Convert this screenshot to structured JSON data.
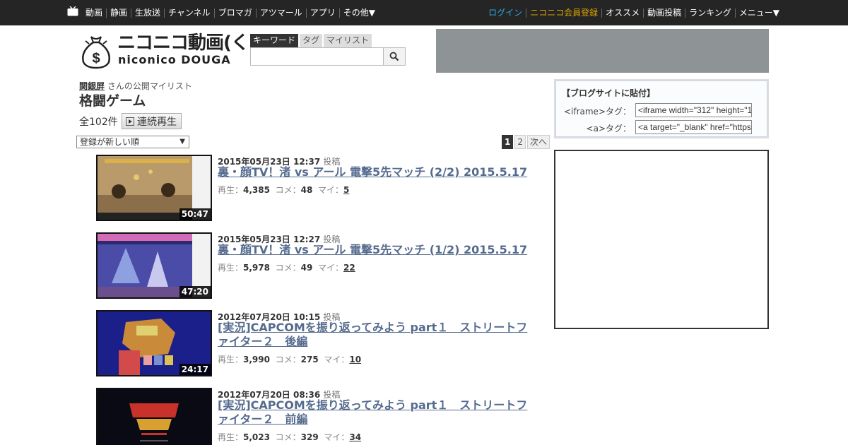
{
  "topbar": {
    "left_nav": [
      "動画",
      "静画",
      "生放送",
      "チャンネル",
      "ブロマガ",
      "アツマール",
      "アプリ",
      "その他▼"
    ],
    "login": "ログイン",
    "premium": "ニコニコ会員登録",
    "right_nav": [
      "オススメ",
      "動画投稿",
      "ランキング",
      "メニュー▼"
    ]
  },
  "logo": {
    "jp": "ニコニコ動画(く)",
    "en": "niconico DOUGA"
  },
  "search": {
    "tabs": [
      "キーワード",
      "タグ",
      "マイリスト"
    ],
    "placeholder": ""
  },
  "mylist": {
    "owner": "関銀屏",
    "owner_suffix": " さんの公開マイリスト",
    "title": "格闘ゲーム",
    "count": "全102件",
    "play_all": "連続再生",
    "sort": "登録が新しい順"
  },
  "pager": {
    "current": "1",
    "page2": "2",
    "next": "次へ"
  },
  "stats_labels": {
    "play": "再生：",
    "comment": "コメ：",
    "mylist": "マイ：",
    "posted": "投稿"
  },
  "videos": [
    {
      "date": "2015年05月23日 12:37",
      "title": "裏・顔TV！渚 vs アール 電撃5先マッチ (2/2) 2015.5.17",
      "duration": "50:47",
      "plays": "4,385",
      "comments": "48",
      "mylists": "5"
    },
    {
      "date": "2015年05月23日 12:27",
      "title": "裏・顔TV！渚 vs アール 電撃5先マッチ (1/2) 2015.5.17",
      "duration": "47:20",
      "plays": "5,978",
      "comments": "49",
      "mylists": "22"
    },
    {
      "date": "2012年07月20日 10:15",
      "title": "[実況]CAPCOMを振り返ってみよう part１　ストリートファイター２　後編",
      "duration": "24:17",
      "plays": "3,990",
      "comments": "275",
      "mylists": "10"
    },
    {
      "date": "2012年07月20日 08:36",
      "title": "[実況]CAPCOMを振り返ってみよう part１　ストリートファイター２　前編",
      "duration": "",
      "plays": "5,023",
      "comments": "329",
      "mylists": "34"
    }
  ],
  "blog_box": {
    "heading": "【ブログサイトに貼付】",
    "iframe_label": "<iframe>タグ：",
    "iframe_value": "<iframe width=\"312\" height=\"1",
    "a_label": "<a>タグ：",
    "a_value": "<a target=\"_blank\" href=\"https"
  },
  "colors": {
    "topbar": "#252525",
    "link": "#556b8e",
    "login": "#2ea7e0",
    "premium": "#d9a300",
    "ad": "#8e9396"
  }
}
